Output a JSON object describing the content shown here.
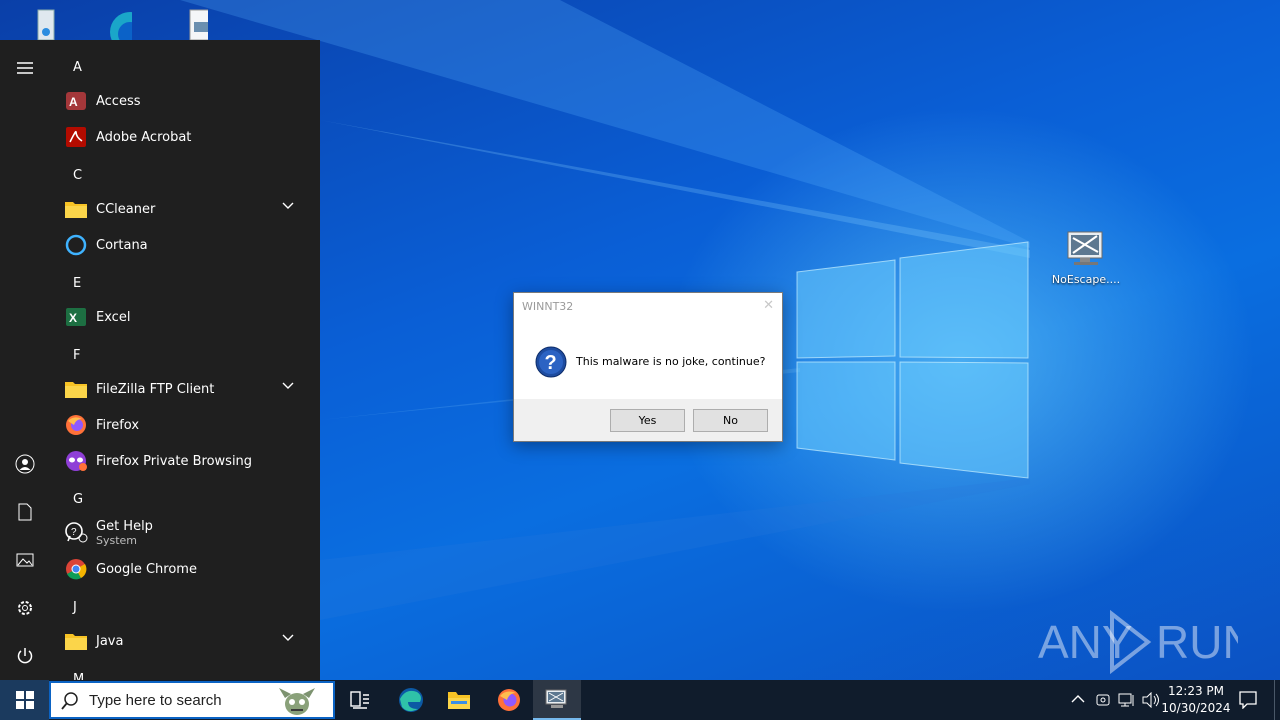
{
  "desktop": {
    "icons": [
      {
        "name": "Recycle Bin",
        "label": ""
      },
      {
        "name": "Microsoft Edge",
        "label": ""
      },
      {
        "name": "File",
        "label": ""
      },
      {
        "name": "NoEscape",
        "label": "NoEscape...."
      }
    ],
    "watermark": "ANY RUN"
  },
  "start_menu": {
    "sections": [
      {
        "letter": "A",
        "apps": [
          {
            "name": "Access"
          },
          {
            "name": "Adobe Acrobat"
          }
        ]
      },
      {
        "letter": "C",
        "apps": [
          {
            "name": "CCleaner",
            "expandable": true
          },
          {
            "name": "Cortana"
          }
        ]
      },
      {
        "letter": "E",
        "apps": [
          {
            "name": "Excel"
          }
        ]
      },
      {
        "letter": "F",
        "apps": [
          {
            "name": "FileZilla FTP Client",
            "expandable": true
          },
          {
            "name": "Firefox"
          },
          {
            "name": "Firefox Private Browsing"
          }
        ]
      },
      {
        "letter": "G",
        "apps": [
          {
            "name": "Get Help",
            "subtitle": "System"
          },
          {
            "name": "Google Chrome"
          }
        ]
      },
      {
        "letter": "J",
        "apps": [
          {
            "name": "Java",
            "expandable": true
          }
        ]
      },
      {
        "letter": "M",
        "apps": []
      }
    ],
    "rail": [
      "hamburger-icon",
      "user-icon",
      "documents-icon",
      "pictures-icon",
      "settings-icon",
      "power-icon"
    ]
  },
  "dialog": {
    "title": "WINNT32",
    "close": "✕",
    "message": "This malware is no joke, continue?",
    "yes_label": "Yes",
    "no_label": "No"
  },
  "taskbar": {
    "search_placeholder": "Type here to search",
    "pinned": [
      "Task View",
      "Microsoft Edge",
      "File Explorer",
      "Firefox",
      "NoEscape"
    ],
    "clock_time": "12:23 PM",
    "clock_date": "10/30/2024"
  },
  "colors": {
    "desktop_blue": "#0a5fd6",
    "start_bg": "#1f1f1f",
    "taskbar_bg": "#101c2c",
    "dialog_footer": "#f0f0f0"
  }
}
